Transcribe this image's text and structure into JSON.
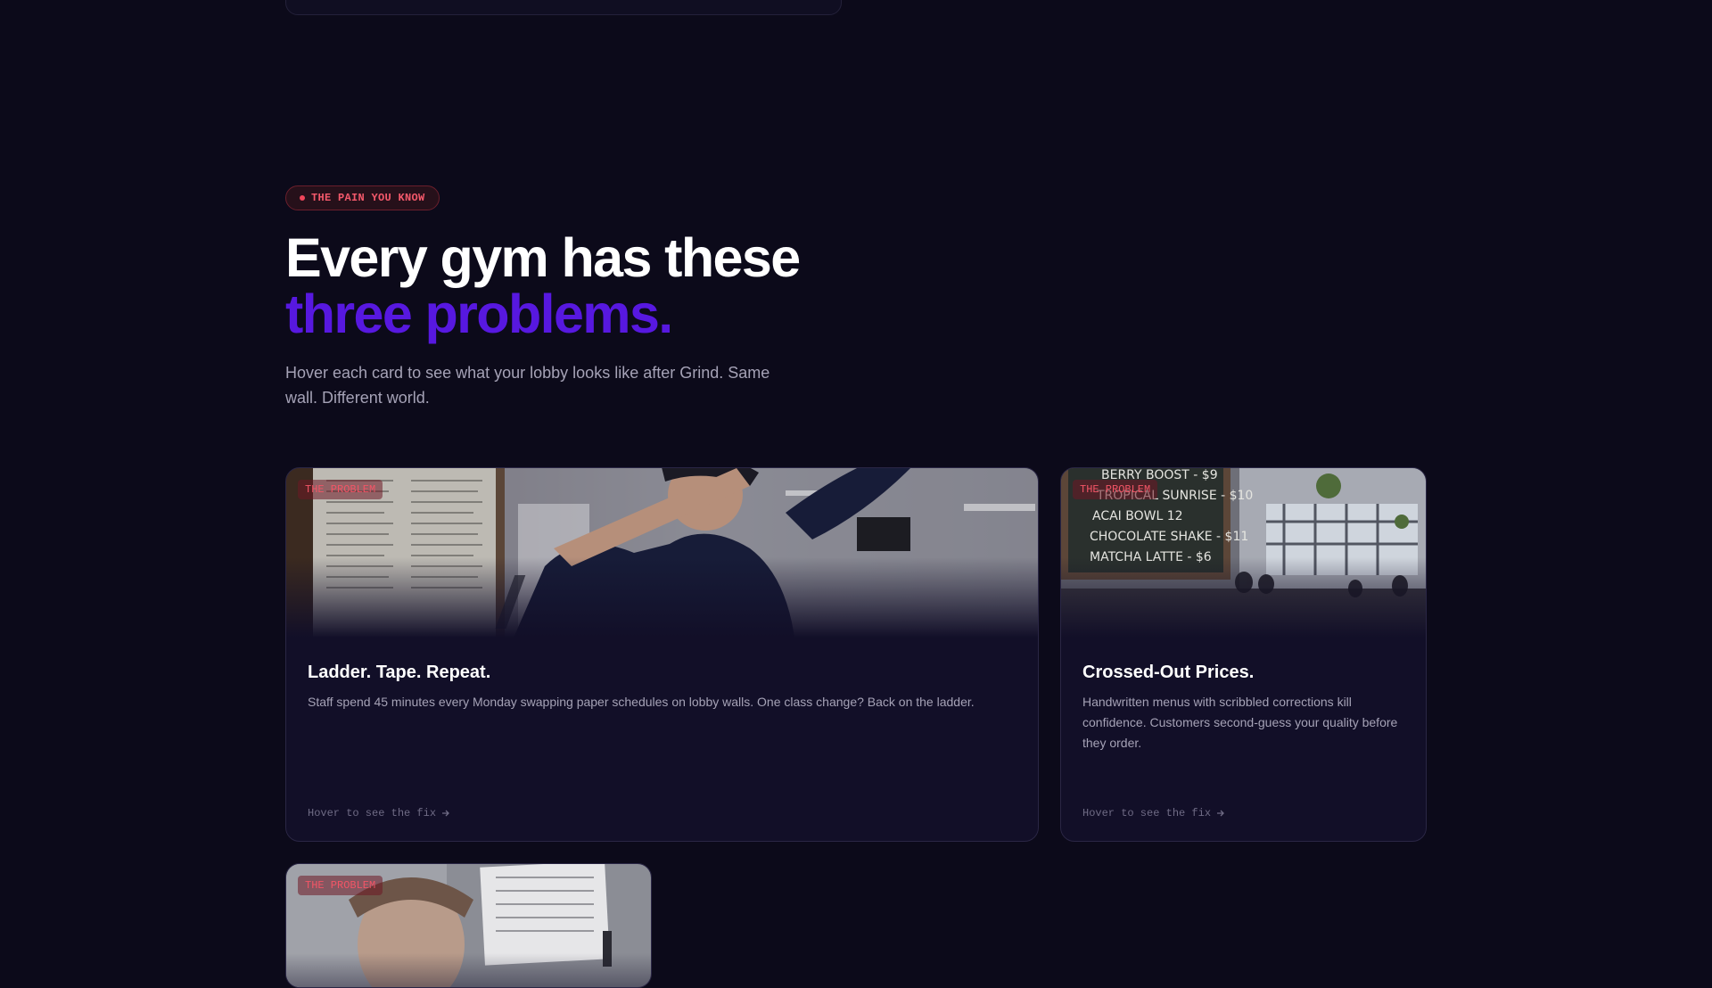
{
  "section": {
    "eyebrow": "THE PAIN YOU KNOW",
    "title_line1": "Every gym has these",
    "title_line2": "three problems.",
    "description": "Hover each card to see what your lobby looks like after Grind. Same wall. Different world."
  },
  "cards": [
    {
      "tag": "THE PROBLEM",
      "title": "Ladder. Tape. Repeat.",
      "description": "Staff spend 45 minutes every Monday swapping paper schedules on lobby walls. One class change? Back on the ladder.",
      "hint": "Hover to see the fix",
      "hint_icon": "arrow-right-icon",
      "image": "gym staff on a ladder taping paper schedules to a lobby wall"
    },
    {
      "tag": "THE PROBLEM",
      "title": "Crossed-Out Prices.",
      "description": "Handwritten menus with scribbled corrections kill confidence. Customers second-guess your quality before they order.",
      "hint": "Hover to see the fix",
      "hint_icon": "arrow-right-icon",
      "image": "cafe chalkboard menu with handwritten items and prices",
      "menu_lines": [
        "BERRY BOOST - $9",
        "TROPICAL SUNRISE - $10",
        "ACAI BOWL 12",
        "CHOCOLATE SHAKE - $11",
        "MATCHA LATTE - $6"
      ]
    },
    {
      "tag": "THE PROBLEM",
      "image": "person reading a printed paper schedule"
    }
  ],
  "colors": {
    "background": "#0c0a1a",
    "card": "#120f28",
    "accent": "#5718e0",
    "problem_red": "#f4596b"
  }
}
